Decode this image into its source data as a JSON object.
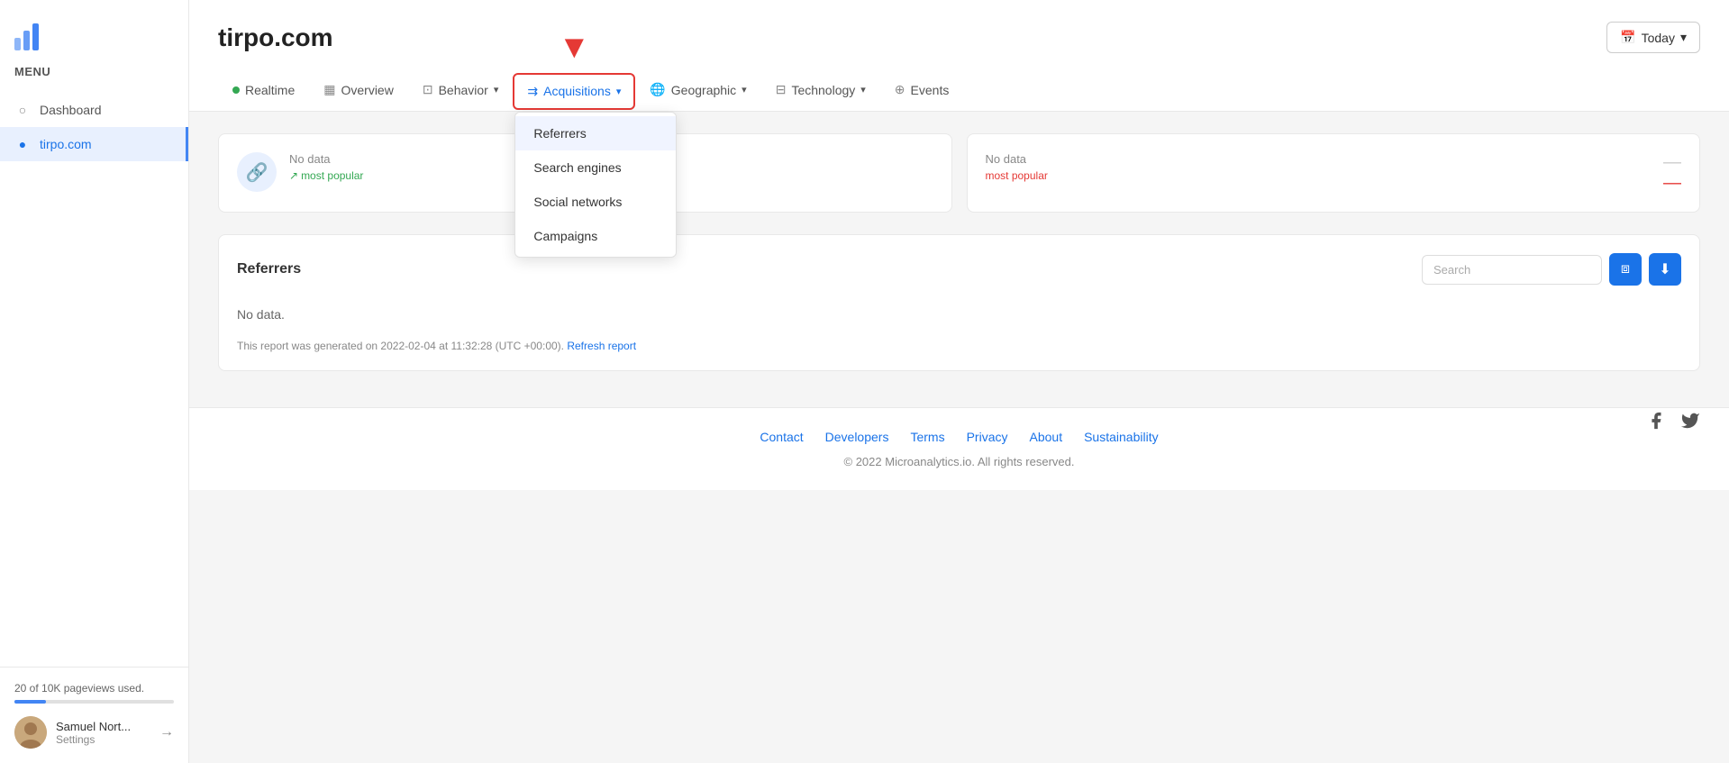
{
  "sidebar": {
    "menu_label": "MENU",
    "items": [
      {
        "id": "dashboard",
        "label": "Dashboard",
        "icon": "circle",
        "active": false
      },
      {
        "id": "tirpo",
        "label": "tirpo.com",
        "icon": "dot",
        "active": true
      }
    ],
    "pageviews_text": "20 of 10K pageviews used.",
    "user": {
      "name": "Samuel Nort...",
      "settings_label": "Settings"
    }
  },
  "header": {
    "site_title": "tirpo.com",
    "date_button": "Today"
  },
  "nav": {
    "tabs": [
      {
        "id": "realtime",
        "label": "Realtime",
        "has_dot": true
      },
      {
        "id": "overview",
        "label": "Overview",
        "has_icon": true
      },
      {
        "id": "behavior",
        "label": "Behavior",
        "has_chevron": true
      },
      {
        "id": "acquisitions",
        "label": "Acquisitions",
        "has_chevron": true,
        "highlighted": true
      },
      {
        "id": "geographic",
        "label": "Geographic",
        "has_chevron": true
      },
      {
        "id": "technology",
        "label": "Technology",
        "has_chevron": true
      },
      {
        "id": "events",
        "label": "Events",
        "has_icon": true
      }
    ]
  },
  "acquisitions_dropdown": {
    "items": [
      {
        "id": "referrers",
        "label": "Referrers",
        "active": true
      },
      {
        "id": "search_engines",
        "label": "Search engines"
      },
      {
        "id": "social_networks",
        "label": "Social networks"
      },
      {
        "id": "campaigns",
        "label": "Campaigns"
      }
    ]
  },
  "stats": {
    "card1": {
      "label": "No data",
      "trend": "most popular"
    },
    "card2": {
      "label": "No data",
      "trend": "most popular",
      "trend_type": "negative"
    }
  },
  "table": {
    "title": "Referrers",
    "search_placeholder": "Search",
    "no_data_text": "No data.",
    "report_text": "This report was generated on 2022-02-04 at 11:32:28 (UTC +00:00).",
    "refresh_label": "Refresh report"
  },
  "footer": {
    "links": [
      {
        "id": "contact",
        "label": "Contact"
      },
      {
        "id": "developers",
        "label": "Developers"
      },
      {
        "id": "terms",
        "label": "Terms"
      },
      {
        "id": "privacy",
        "label": "Privacy"
      },
      {
        "id": "about",
        "label": "About"
      },
      {
        "id": "sustainability",
        "label": "Sustainability"
      }
    ],
    "copyright": "© 2022 Microanalytics.io. All rights reserved."
  }
}
